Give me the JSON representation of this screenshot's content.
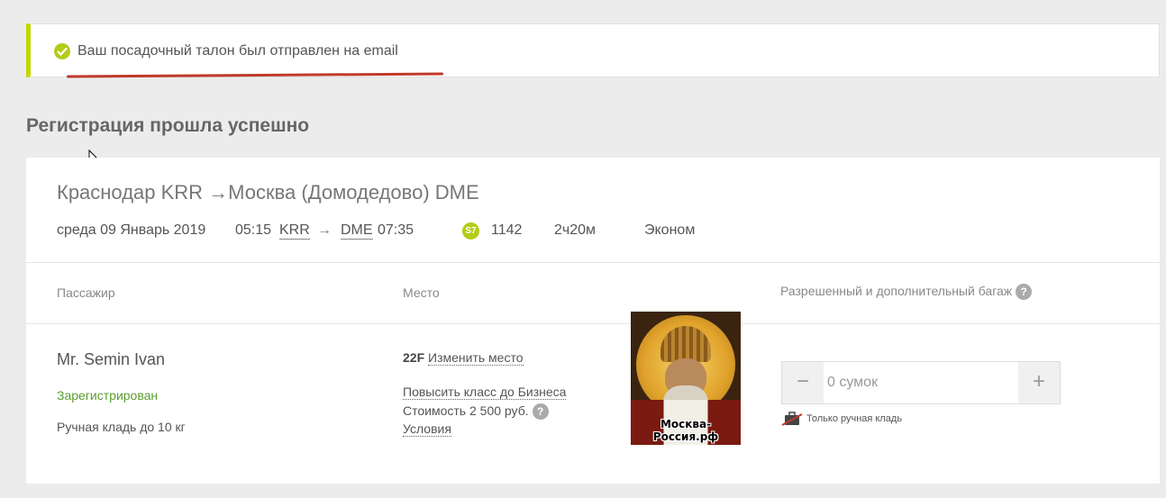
{
  "notice": {
    "message": "Ваш посадочный талон был отправлен на email",
    "accent_color": "#c4d600",
    "icon": "check-circle-icon"
  },
  "section_title": "Регистрация прошла успешно",
  "flight": {
    "route": "Краснодар KRR →Москва (Домодедово) DME",
    "date": "среда 09 Январь 2019",
    "departure_time": "05:15",
    "departure_code": "KRR",
    "arrow": "→",
    "arrival_code": "DME",
    "arrival_time": "07:35",
    "airline_logo": "S7",
    "flight_number": "1142",
    "duration": "2ч20м",
    "cabin_class": "Эконом"
  },
  "columns": {
    "passenger": "Пассажир",
    "seat": "Место",
    "baggage": "Разрешенный и дополнительный багаж",
    "help_mark": "?"
  },
  "passenger": {
    "name": "Mr. Semin Ivan",
    "status": "Зарегистрирован",
    "hand_luggage": "Ручная кладь до 10 кг"
  },
  "seat": {
    "number": "22F",
    "change_link": "Изменить место",
    "upgrade_link": "Повысить класс до Бизнеса",
    "upgrade_price": "Стоимость 2 500 руб.",
    "conditions_link": "Условия"
  },
  "overlay_image": {
    "watermark_line1": "Москва-",
    "watermark_line2": "Россия.рф"
  },
  "baggage": {
    "minus": "−",
    "value": "0 сумок",
    "plus": "+",
    "hand_only": "Только ручная кладь"
  }
}
